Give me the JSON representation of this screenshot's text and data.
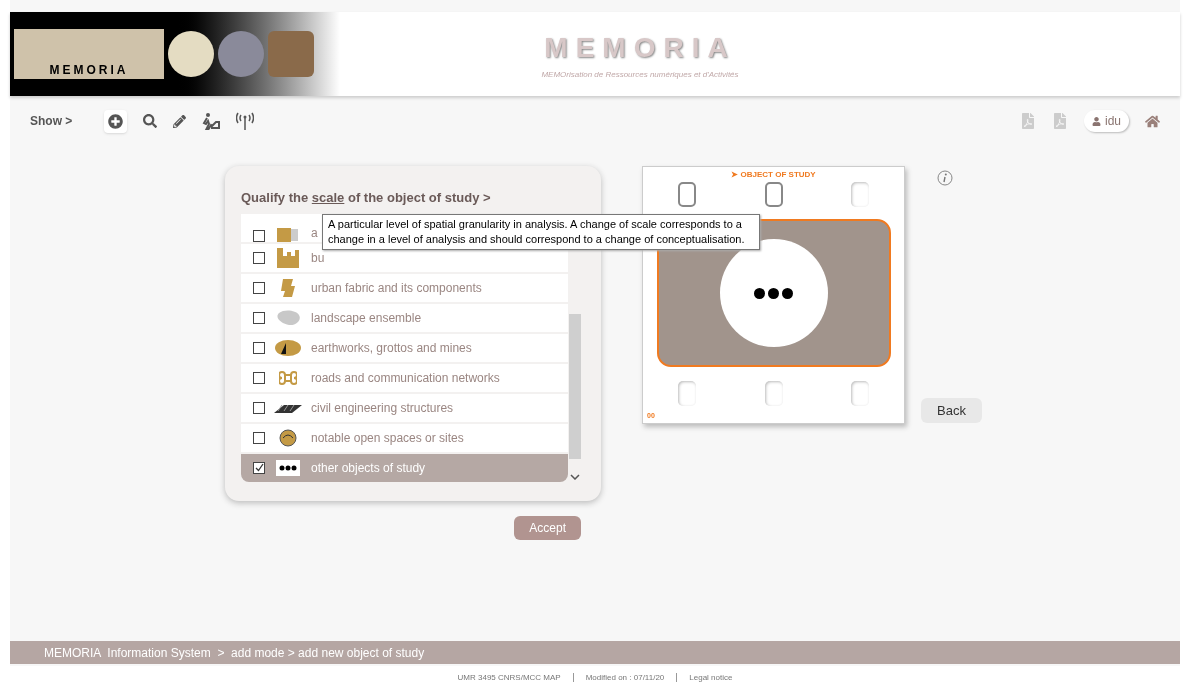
{
  "header": {
    "logo_text": "MEMORIA",
    "title": "MEMORIA",
    "subtitle": "MEMOrisation de Ressources numériques et d'Activités"
  },
  "toolbar": {
    "show_label": "Show >",
    "user": "idu"
  },
  "scale_panel": {
    "title_before": "Qualify the ",
    "title_link": "scale",
    "title_after": " of the object of study >",
    "items": [
      {
        "label": "a",
        "checked": false,
        "selected": false
      },
      {
        "label": "bu",
        "checked": false,
        "selected": false
      },
      {
        "label": "urban fabric and its components",
        "checked": false,
        "selected": false
      },
      {
        "label": "landscape ensemble",
        "checked": false,
        "selected": false
      },
      {
        "label": "earthworks, grottos and mines",
        "checked": false,
        "selected": false
      },
      {
        "label": "roads and communication networks",
        "checked": false,
        "selected": false
      },
      {
        "label": "civil engineering structures",
        "checked": false,
        "selected": false
      },
      {
        "label": "notable open spaces or sites",
        "checked": false,
        "selected": false
      },
      {
        "label": "other objects of study",
        "checked": true,
        "selected": true
      }
    ],
    "tooltip": "A particular level of spatial granularity in analysis. A change of scale corresponds to a change in a level of analysis and should correspond to a change of conceptualisation.",
    "accept": "Accept"
  },
  "film_card": {
    "heading": "➤ OBJECT OF STUDY",
    "counter": "00",
    "back": "Back"
  },
  "breadcrumb": "MEMORIA  Information System  >  add mode > add new object of study",
  "footer": [
    "UMR 3495 CNRS/MCC MAP",
    "Modified on : 07/11/20",
    "Legal notice"
  ]
}
